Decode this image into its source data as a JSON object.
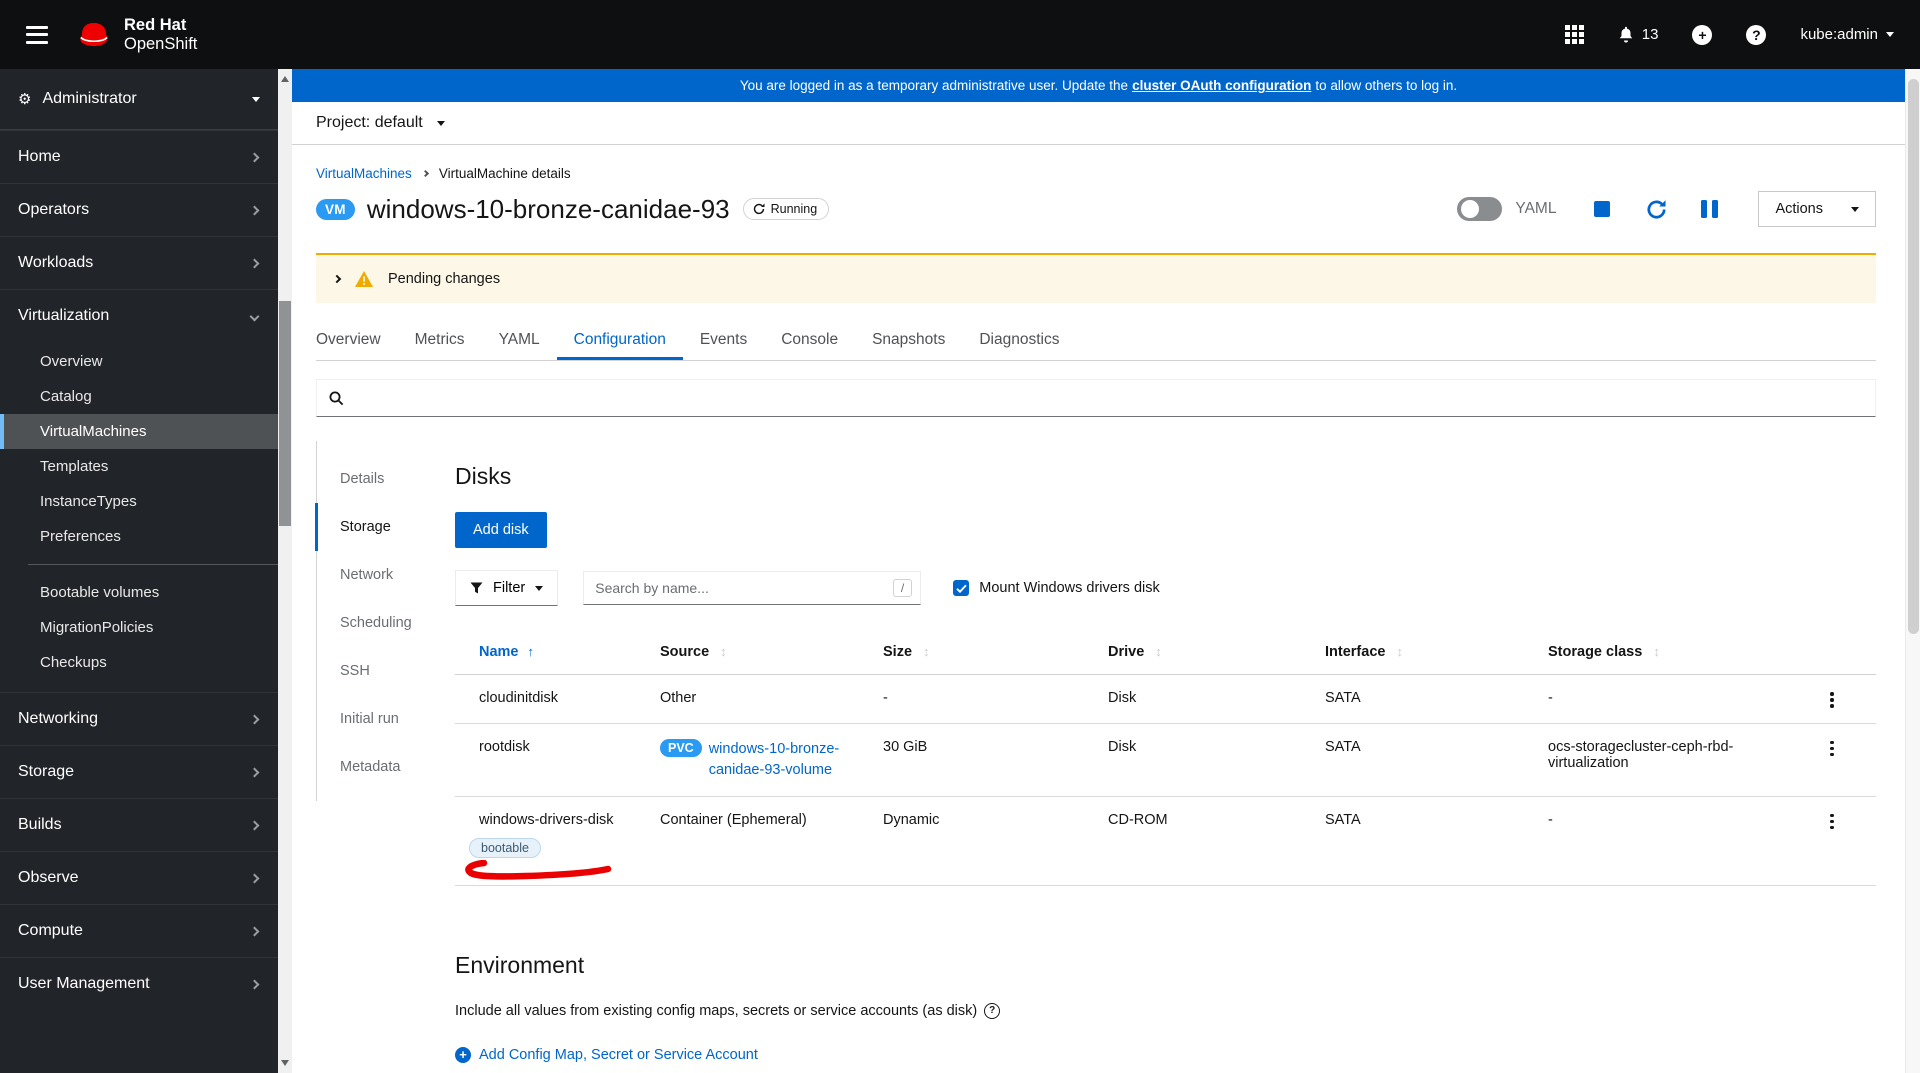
{
  "masthead": {
    "brand": {
      "line1": "Red Hat",
      "line2": "OpenShift"
    },
    "notifications_count": "13",
    "user": "kube:admin"
  },
  "banner": {
    "prefix": "You are logged in as a temporary administrative user. Update the",
    "link_text": "cluster OAuth configuration",
    "suffix": "to allow others to log in."
  },
  "project_bar": {
    "label": "Project: default"
  },
  "breadcrumb": [
    "VirtualMachines",
    "VirtualMachine details"
  ],
  "header": {
    "badge": "VM",
    "title": "windows-10-bronze-canidae-93",
    "status": "Running",
    "yaml_label": "YAML",
    "actions_label": "Actions"
  },
  "alert": {
    "title": "Pending changes"
  },
  "tabs": {
    "items": [
      "Overview",
      "Metrics",
      "YAML",
      "Configuration",
      "Events",
      "Console",
      "Snapshots",
      "Diagnostics"
    ],
    "active": "Configuration"
  },
  "config_nav": {
    "items": [
      "Details",
      "Storage",
      "Network",
      "Scheduling",
      "SSH",
      "Initial run",
      "Metadata"
    ],
    "active": "Storage"
  },
  "disks": {
    "heading": "Disks",
    "add_button": "Add disk",
    "filter_button": "Filter",
    "search_placeholder": "Search by name...",
    "search_shortcut": "/",
    "mount_checkbox": "Mount Windows drivers disk",
    "columns": [
      "Name",
      "Source",
      "Size",
      "Drive",
      "Interface",
      "Storage class"
    ],
    "sorted_by": "Name",
    "rows": [
      {
        "name": "cloudinitdisk",
        "source": "Other",
        "size": "-",
        "drive": "Disk",
        "interface": "SATA",
        "storage_class": "-"
      },
      {
        "name": "rootdisk",
        "source_badge": "PVC",
        "source_link": "windows-10-bronze-canidae-93-volume",
        "size": "30 GiB",
        "drive": "Disk",
        "interface": "SATA",
        "storage_class": "ocs-storagecluster-ceph-rbd-virtualization"
      },
      {
        "name": "windows-drivers-disk",
        "name_label": "bootable",
        "source": "Container (Ephemeral)",
        "size": "Dynamic",
        "drive": "CD-ROM",
        "interface": "SATA",
        "storage_class": "-"
      }
    ]
  },
  "environment": {
    "heading": "Environment",
    "description": "Include all values from existing config maps, secrets or service accounts (as disk)",
    "add_link": "Add Config Map, Secret or Service Account"
  },
  "sidebar": {
    "perspective": "Administrator",
    "sections_top": [
      "Home",
      "Operators",
      "Workloads"
    ],
    "virtualization": {
      "label": "Virtualization",
      "children": [
        "Overview",
        "Catalog",
        "VirtualMachines",
        "Templates",
        "InstanceTypes",
        "Preferences"
      ],
      "children_secondary": [
        "Bootable volumes",
        "MigrationPolicies",
        "Checkups"
      ],
      "active": "VirtualMachines"
    },
    "sections_bottom": [
      "Networking",
      "Storage",
      "Builds",
      "Observe",
      "Compute",
      "User Management"
    ]
  },
  "colors": {
    "accent": "#0066cc",
    "banner_blue": "#0066cc",
    "warning_gold": "#f0ab00",
    "resource_badge_blue": "#2b9af3",
    "annotation_red": "#ea0000"
  }
}
